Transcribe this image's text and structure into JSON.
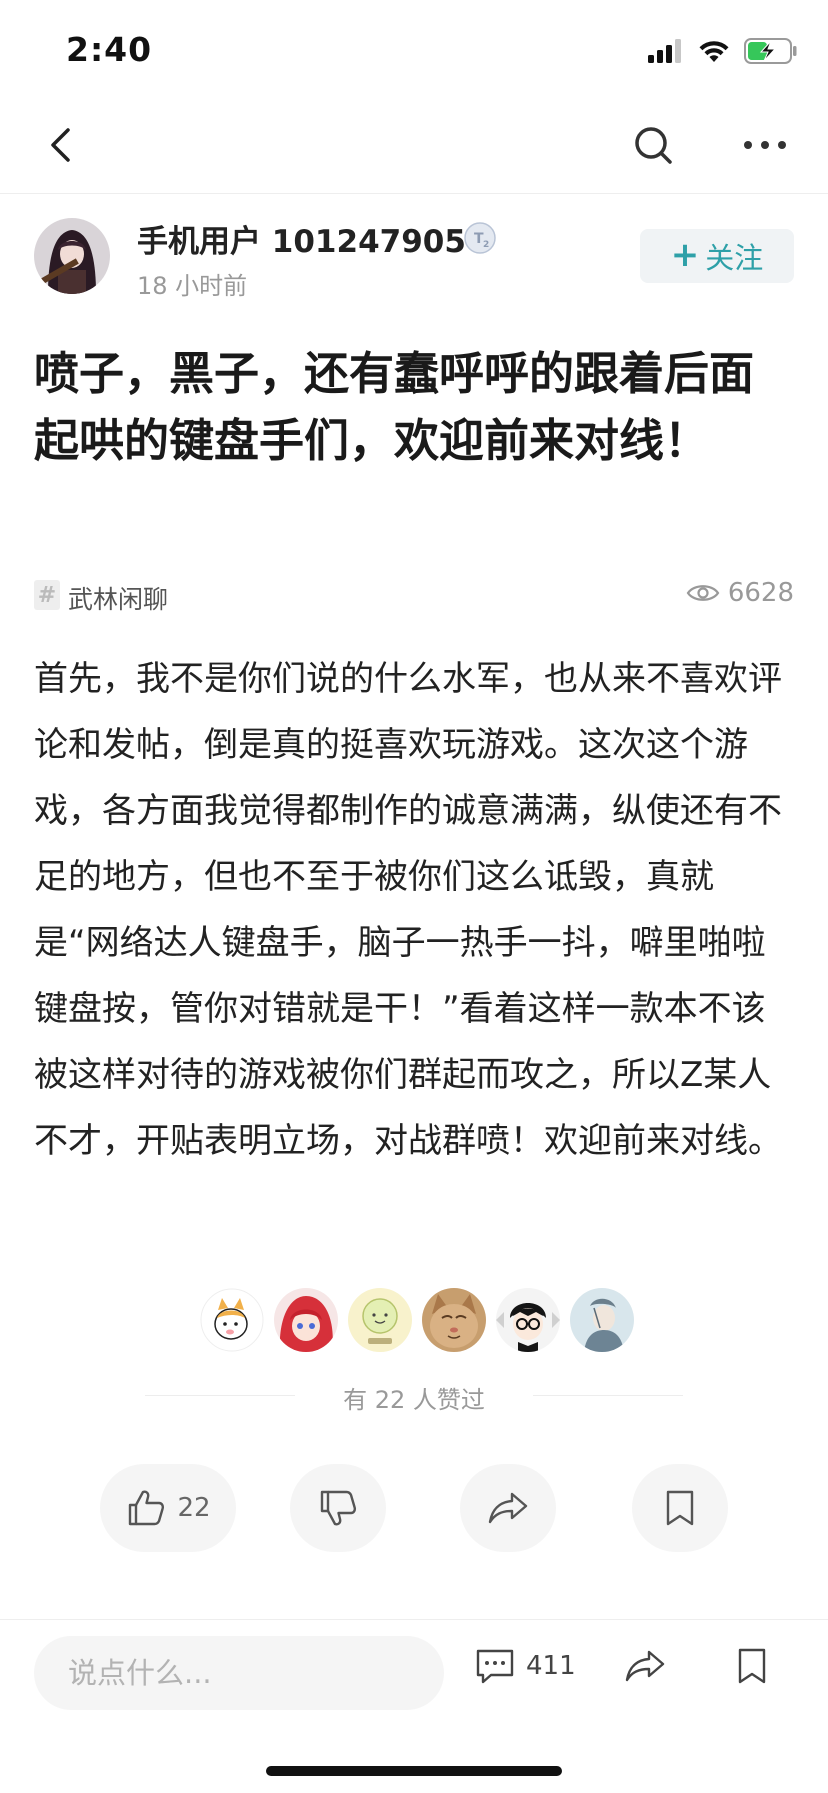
{
  "status_bar": {
    "time": "2:40",
    "icons": [
      "cellular-signal-icon",
      "wifi-icon",
      "battery-charging-icon"
    ]
  },
  "nav": {
    "icons": [
      "back-arrow-icon",
      "search-icon",
      "more-icon"
    ]
  },
  "author": {
    "name": "手机用户 101247905",
    "level_badge": "T2",
    "time_ago": "18 小时前",
    "follow_label": "关注",
    "follow_icon": "plus-icon"
  },
  "post": {
    "title": "喷子，黑子，还有蠢呼呼的跟着后面起哄的键盘手们，欢迎前来对线！",
    "topic": "武林闲聊",
    "topic_icon": "hash-icon",
    "views": "6628",
    "body": "首先，我不是你们说的什么水军，也从来不喜欢评论和发帖，倒是真的挺喜欢玩游戏。这次这个游戏，各方面我觉得都制作的诚意满满，纵使还有不足的地方，但也不至于被你们这么诋毁，真就是“网络达人键盘手，脑子一热手一抖，噼里啪啦键盘按，管你对错就是干！”看着这样一款本不该被这样对待的游戏被你们群起而攻之，所以Z某人不才，开贴表明立场，对战群喷！欢迎前来对线。"
  },
  "likes": {
    "summary": "有 22 人赞过",
    "liker_avatars": [
      "cat-avatar",
      "red-hair-girl-avatar",
      "green-blob-avatar",
      "tabby-cat-avatar",
      "glasses-boy-avatar",
      "sketch-avatar"
    ]
  },
  "actions": {
    "like_count": "22",
    "icons": [
      "thumbs-up-icon",
      "thumbs-down-icon",
      "share-icon",
      "bookmark-icon"
    ]
  },
  "bottom_bar": {
    "comment_placeholder": "说点什么...",
    "comment_count": "411",
    "icons": [
      "comment-icon",
      "share-icon",
      "bookmark-icon"
    ]
  },
  "colors": {
    "accent": "#2ea0a8",
    "muted": "#999999",
    "pill_bg": "#f5f5f5"
  }
}
